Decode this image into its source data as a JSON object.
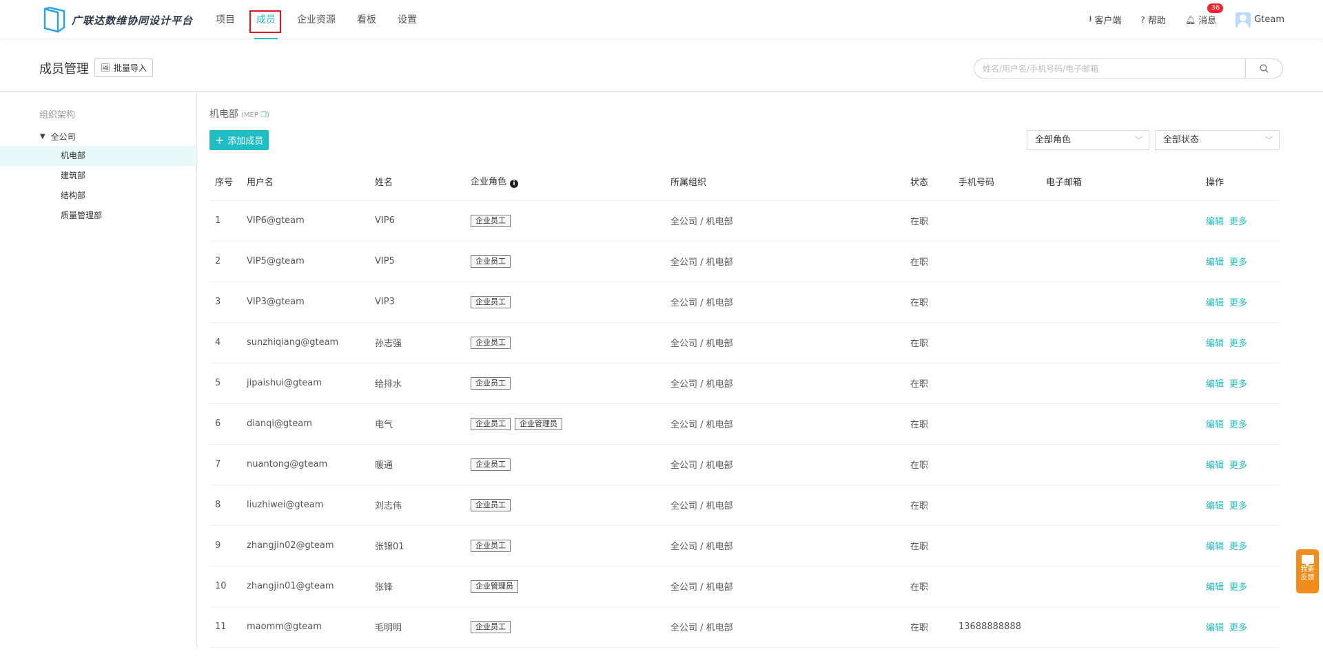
{
  "app": {
    "title": "广联达数维协同设计平台"
  },
  "nav": {
    "items": [
      {
        "label": "项目"
      },
      {
        "label": "成员"
      },
      {
        "label": "企业资源"
      },
      {
        "label": "看板"
      },
      {
        "label": "设置"
      }
    ],
    "active": "成员"
  },
  "topright": {
    "client": "客户端",
    "help": "帮助",
    "messages": "消息",
    "message_count": "36",
    "username": "Gteam"
  },
  "subheader": {
    "title": "成员管理",
    "import_label": "批量导入",
    "search_placeholder": "姓名/用户名/手机号码/电子邮箱"
  },
  "sidebar": {
    "title": "组织架构",
    "root": "全公司",
    "items": [
      {
        "label": "机电部"
      },
      {
        "label": "建筑部"
      },
      {
        "label": "结构部"
      },
      {
        "label": "质量管理部"
      }
    ]
  },
  "main": {
    "dept_name": "机电部",
    "dept_code": "MEP",
    "add_label": "添加成员",
    "role_filter": "全部角色",
    "status_filter": "全部状态",
    "columns": [
      "序号",
      "用户名",
      "姓名",
      "企业角色",
      "所属组织",
      "状态",
      "手机号码",
      "电子邮箱",
      "操作"
    ],
    "edit_label": "编辑",
    "more_label": "更多",
    "rows": [
      {
        "no": "1",
        "username": "VIP6@gteam",
        "name": "VIP6",
        "roles": [
          "企业员工"
        ],
        "org": "全公司 / 机电部",
        "status": "在职",
        "phone": "",
        "email": ""
      },
      {
        "no": "2",
        "username": "VIP5@gteam",
        "name": "VIP5",
        "roles": [
          "企业员工"
        ],
        "org": "全公司 / 机电部",
        "status": "在职",
        "phone": "",
        "email": ""
      },
      {
        "no": "3",
        "username": "VIP3@gteam",
        "name": "VIP3",
        "roles": [
          "企业员工"
        ],
        "org": "全公司 / 机电部",
        "status": "在职",
        "phone": "",
        "email": ""
      },
      {
        "no": "4",
        "username": "sunzhiqiang@gteam",
        "name": "孙志强",
        "roles": [
          "企业员工"
        ],
        "org": "全公司 / 机电部",
        "status": "在职",
        "phone": "",
        "email": ""
      },
      {
        "no": "5",
        "username": "jipaishui@gteam",
        "name": "给排水",
        "roles": [
          "企业员工"
        ],
        "org": "全公司 / 机电部",
        "status": "在职",
        "phone": "",
        "email": ""
      },
      {
        "no": "6",
        "username": "dianqi@gteam",
        "name": "电气",
        "roles": [
          "企业员工",
          "企业管理员"
        ],
        "org": "全公司 / 机电部",
        "status": "在职",
        "phone": "",
        "email": ""
      },
      {
        "no": "7",
        "username": "nuantong@gteam",
        "name": "暖通",
        "roles": [
          "企业员工"
        ],
        "org": "全公司 / 机电部",
        "status": "在职",
        "phone": "",
        "email": ""
      },
      {
        "no": "8",
        "username": "liuzhiwei@gteam",
        "name": "刘志伟",
        "roles": [
          "企业员工"
        ],
        "org": "全公司 / 机电部",
        "status": "在职",
        "phone": "",
        "email": ""
      },
      {
        "no": "9",
        "username": "zhangjin02@gteam",
        "name": "张锦01",
        "roles": [
          "企业员工"
        ],
        "org": "全公司 / 机电部",
        "status": "在职",
        "phone": "",
        "email": ""
      },
      {
        "no": "10",
        "username": "zhangjin01@gteam",
        "name": "张锋",
        "roles": [
          "企业管理员"
        ],
        "org": "全公司 / 机电部",
        "status": "在职",
        "phone": "",
        "email": ""
      },
      {
        "no": "11",
        "username": "maomm@gteam",
        "name": "毛明明",
        "roles": [
          "企业员工"
        ],
        "org": "全公司 / 机电部",
        "status": "在职",
        "phone": "13688888888",
        "email": ""
      }
    ]
  },
  "feedback": {
    "line1": "我要",
    "line2": "反馈"
  },
  "colors": {
    "accent": "#1fbdc4",
    "highlight_box": "#e5141b",
    "feedback_bg": "#f28c1b",
    "badge": "#f5222d"
  }
}
